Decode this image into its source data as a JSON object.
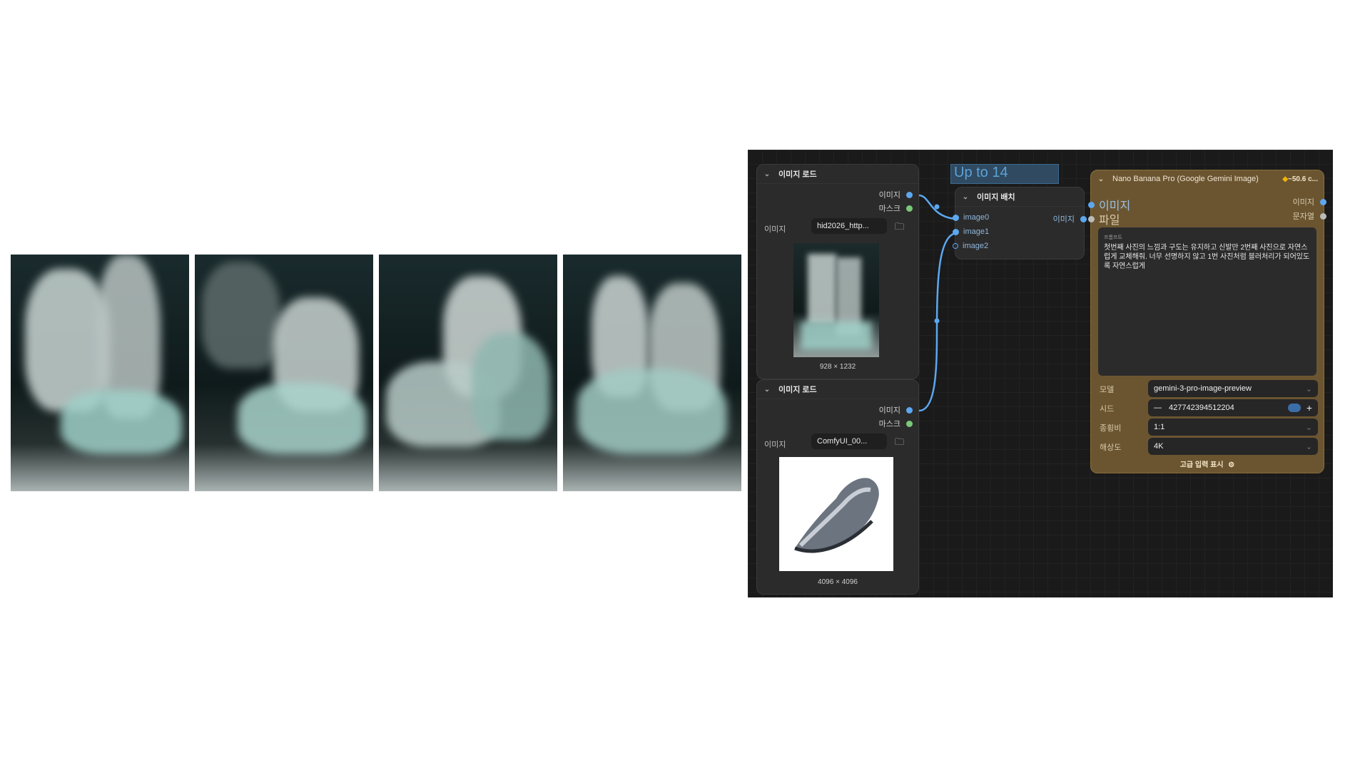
{
  "nodes": {
    "load_image_1": {
      "title": "이미지 로드",
      "output_image": "이미지",
      "output_mask": "마스크",
      "image_label": "이미지",
      "image_value": "hid2026_http...",
      "dimensions": "928 × 1232"
    },
    "load_image_2": {
      "title": "이미지 로드",
      "output_image": "이미지",
      "output_mask": "마스크",
      "image_label": "이미지",
      "image_value": "ComfyUI_00...",
      "dimensions": "4096 × 4096"
    },
    "group": {
      "title": "Up to 14"
    },
    "batch": {
      "title": "이미지 배치",
      "inputs": [
        "image0",
        "image1",
        "image2"
      ],
      "output": "이미지"
    },
    "nano": {
      "title": "Nano Banana Pro (Google Gemini Image)",
      "cost_badge": "~50.6 c...",
      "input_image": "이미지",
      "input_file": "파일",
      "output_image": "이미지",
      "output_string": "문자열",
      "prompt_caption": "프롬프트",
      "prompt": "첫번째 사진의 느낌과 구도는 유지하고 신발만 2번째 사진으로 자연스럽게 교체해줘. 너무 선명하지 않고 1번 사진처럼 블러처리가 되어있도록 자연스럽게",
      "model_label": "모델",
      "model_value": "gemini-3-pro-image-preview",
      "seed_label": "시드",
      "seed_value": "427742394512204",
      "ratio_label": "종횡비",
      "ratio_value": "1:1",
      "resolution_label": "해상도",
      "resolution_value": "4K",
      "advanced_label": "고급 입력 표시"
    }
  },
  "colors": {
    "canvas": "#1a1a1a",
    "node": "#2b2b2b",
    "nano_node": "#6b5531",
    "link": "#5ca8f0",
    "mask_port": "#7ac87a"
  }
}
